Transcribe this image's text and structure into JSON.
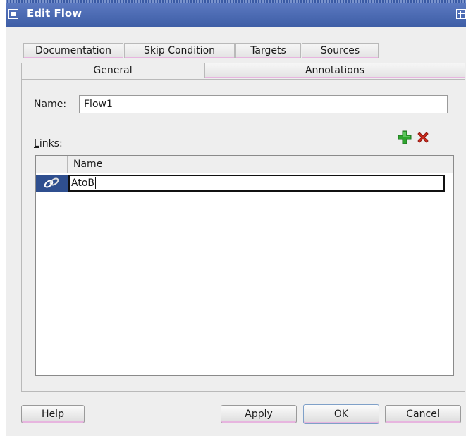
{
  "window": {
    "title": "Edit Flow"
  },
  "tabs": {
    "row_back": [
      "Documentation",
      "Skip Condition",
      "Targets",
      "Sources"
    ],
    "row_front": [
      "General",
      "Annotations"
    ],
    "selected": "General"
  },
  "general": {
    "name_label_prefix": "N",
    "name_label_rest": "ame:",
    "name_value": "Flow1",
    "links_label_prefix": "L",
    "links_label_rest": "inks:",
    "add_icon": "green-plus-icon",
    "delete_icon": "red-x-icon",
    "table": {
      "columns": [
        "",
        "Name"
      ],
      "rows": [
        {
          "icon": "link-icon",
          "name": "AtoB",
          "selected": true,
          "editing": true
        }
      ]
    }
  },
  "buttons": {
    "help_prefix": "H",
    "help_rest": "elp",
    "apply_prefix": "A",
    "apply_rest": "pply",
    "ok": "OK",
    "cancel": "Cancel"
  },
  "colors": {
    "titlebar": "#4a67b0",
    "selected_row": "#2f4f8f",
    "add_icon": "#2fa52f",
    "delete_icon": "#d32b1e",
    "tab_accent": "#e7b5df"
  }
}
